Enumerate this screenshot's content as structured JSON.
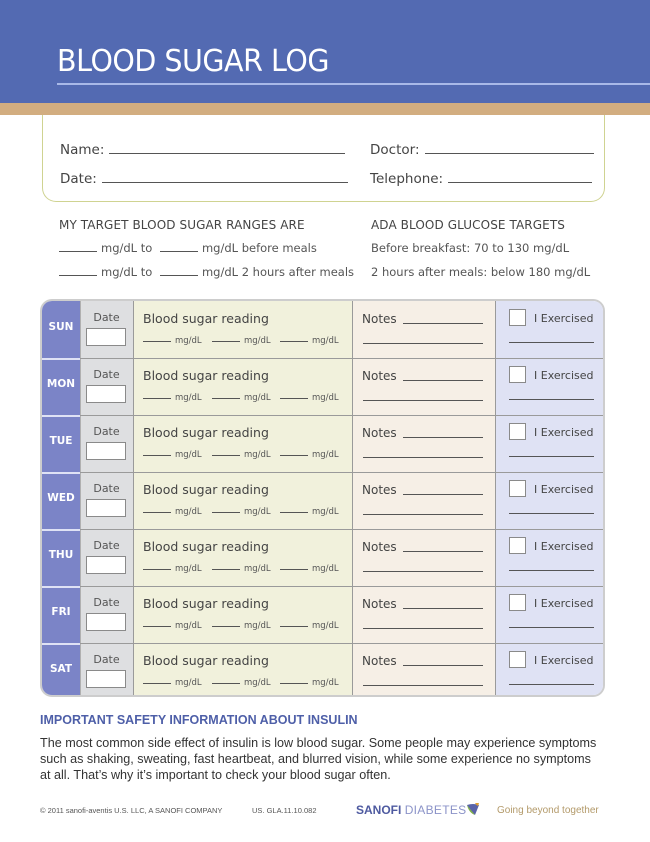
{
  "header": {
    "title": "BLOOD SUGAR LOG"
  },
  "patient_info": {
    "name_label": "Name:",
    "doctor_label": "Doctor:",
    "date_label": "Date:",
    "telephone_label": "Telephone:"
  },
  "my_targets": {
    "heading": "MY TARGET BLOOD SUGAR RANGES ARE",
    "line1_mid": "mg/dL to",
    "line1_end": "mg/dL before meals",
    "line2_mid": "mg/dL to",
    "line2_end": "mg/dL 2 hours after meals"
  },
  "ada_targets": {
    "heading": "ADA BLOOD GLUCOSE TARGETS",
    "line1": "Before breakfast: 70 to 130 mg/dL",
    "line2": "2 hours after meals: below 180 mg/dL"
  },
  "log": {
    "date_label": "Date",
    "reading_label": "Blood sugar reading",
    "unit": "mg/dL",
    "notes_label": "Notes",
    "exercised_label": "I Exercised",
    "days": [
      "SUN",
      "MON",
      "TUE",
      "WED",
      "THU",
      "FRI",
      "SAT"
    ]
  },
  "safety": {
    "heading": "IMPORTANT SAFETY INFORMATION ABOUT INSULIN",
    "body": "The most common side effect of insulin is low blood sugar. Some people may experience symptoms such as shaking, sweating, fast heartbeat, and blurred vision, while some experience no symptoms at all. That’s why it’s important to check your blood sugar often."
  },
  "footer": {
    "copyright": "© 2011 sanofi-aventis U.S. LLC, A SANOFI COMPANY",
    "code": "US. GLA.11.10.082",
    "brand_bold": "SANOFI",
    "brand_light": "DIABETES",
    "logo_icon": "sanofi-logo-icon",
    "tagline": "Going beyond together"
  },
  "colors": {
    "header_blue": "#536ab2",
    "tan_bar": "#d2ad80",
    "day_column": "#7b84c7",
    "reading_column": "#f1f1dc",
    "notes_column": "#f6efe6",
    "exercise_column": "#dfe2f4",
    "safety_heading": "#4e5fa8"
  }
}
